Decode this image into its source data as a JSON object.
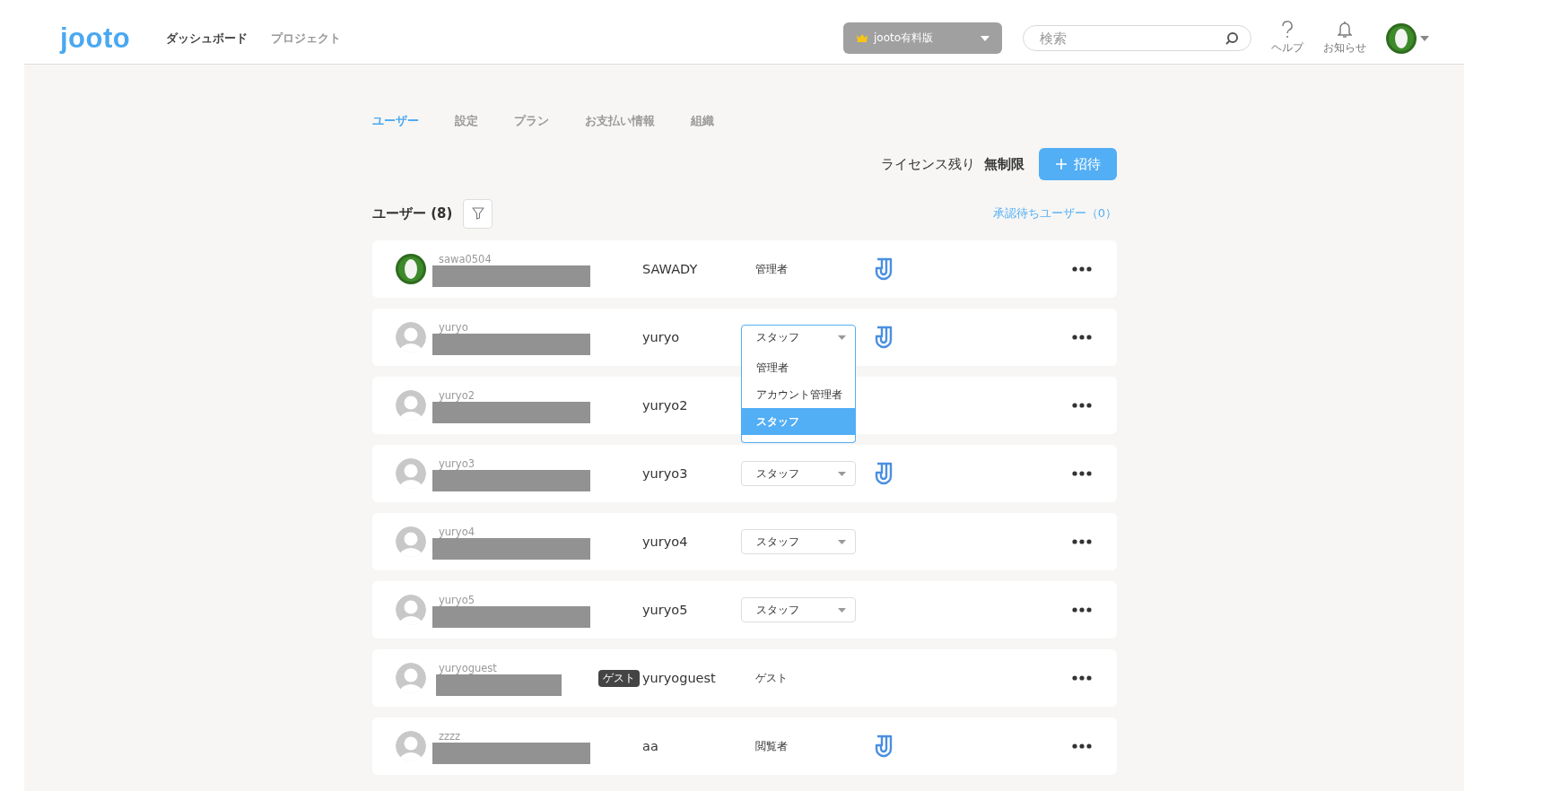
{
  "header": {
    "logo": "jooto",
    "nav": [
      {
        "label": "ダッシュボード",
        "selected": true
      },
      {
        "label": "プロジェクト",
        "selected": false
      }
    ],
    "plan_button": "jooto有料版",
    "search": {
      "placeholder": "検索"
    },
    "help": "ヘルプ",
    "notifications": "お知らせ"
  },
  "tabs": [
    {
      "label": "ユーザー",
      "selected": true
    },
    {
      "label": "設定",
      "selected": false
    },
    {
      "label": "プラン",
      "selected": false
    },
    {
      "label": "お支払い情報",
      "selected": false
    },
    {
      "label": "組織",
      "selected": false
    }
  ],
  "license": {
    "label": "ライセンス残り",
    "value": "無制限"
  },
  "invite_button": "招待",
  "users_heading": "ユーザー (8)",
  "pending_link": "承認待ちユーザー（0）",
  "users": [
    {
      "username": "sawa0504",
      "photo_avatar": true,
      "display_name": "SAWADY",
      "role": {
        "kind": "text",
        "label": "管理者"
      },
      "linked": true
    },
    {
      "username": "yuryo",
      "photo_avatar": false,
      "display_name": "yuryo",
      "role": {
        "kind": "select",
        "label": "スタッフ",
        "expanded": true,
        "options": [
          {
            "label": "管理者",
            "selected": false
          },
          {
            "label": "アカウント管理者",
            "selected": false
          },
          {
            "label": "スタッフ",
            "selected": true
          }
        ]
      },
      "linked": true
    },
    {
      "username": "yuryo2",
      "photo_avatar": false,
      "display_name": "yuryo2",
      "role": {
        "kind": "none"
      },
      "linked": false
    },
    {
      "username": "yuryo3",
      "photo_avatar": false,
      "display_name": "yuryo3",
      "role": {
        "kind": "select",
        "label": "スタッフ",
        "expanded": false
      },
      "linked": true
    },
    {
      "username": "yuryo4",
      "photo_avatar": false,
      "display_name": "yuryo4",
      "role": {
        "kind": "select",
        "label": "スタッフ",
        "expanded": false
      },
      "linked": false
    },
    {
      "username": "yuryo5",
      "photo_avatar": false,
      "display_name": "yuryo5",
      "role": {
        "kind": "select",
        "label": "スタッフ",
        "expanded": false
      },
      "linked": false
    },
    {
      "username": "yuryoguest",
      "photo_avatar": false,
      "badge": "ゲスト",
      "display_name": "yuryoguest",
      "role": {
        "kind": "text",
        "label": "ゲスト"
      },
      "linked": false
    },
    {
      "username": "zzzz",
      "photo_avatar": false,
      "display_name": "aa",
      "role": {
        "kind": "text",
        "label": "閲覧者"
      },
      "linked": true
    }
  ]
}
